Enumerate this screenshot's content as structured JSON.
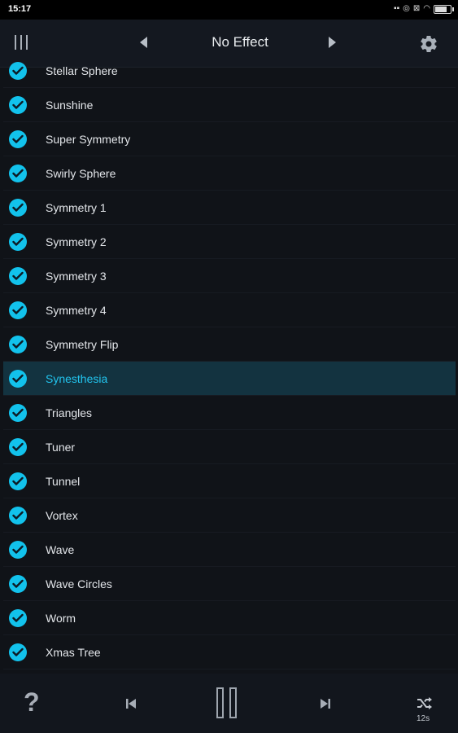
{
  "status": {
    "time": "15:17",
    "icons": [
      "media-icon",
      "screen-record-icon",
      "close-box-icon",
      "wifi-icon",
      "battery-icon"
    ]
  },
  "header": {
    "title": "No Effect"
  },
  "effects": [
    {
      "label": "Stellar Sphere",
      "checked": true,
      "selected": false
    },
    {
      "label": "Sunshine",
      "checked": true,
      "selected": false
    },
    {
      "label": "Super Symmetry",
      "checked": true,
      "selected": false
    },
    {
      "label": "Swirly Sphere",
      "checked": true,
      "selected": false
    },
    {
      "label": "Symmetry 1",
      "checked": true,
      "selected": false
    },
    {
      "label": "Symmetry 2",
      "checked": true,
      "selected": false
    },
    {
      "label": "Symmetry 3",
      "checked": true,
      "selected": false
    },
    {
      "label": "Symmetry 4",
      "checked": true,
      "selected": false
    },
    {
      "label": "Symmetry Flip",
      "checked": true,
      "selected": false
    },
    {
      "label": "Synesthesia",
      "checked": true,
      "selected": true
    },
    {
      "label": "Triangles",
      "checked": true,
      "selected": false
    },
    {
      "label": "Tuner",
      "checked": true,
      "selected": false
    },
    {
      "label": "Tunnel",
      "checked": true,
      "selected": false
    },
    {
      "label": "Vortex",
      "checked": true,
      "selected": false
    },
    {
      "label": "Wave",
      "checked": true,
      "selected": false
    },
    {
      "label": "Wave Circles",
      "checked": true,
      "selected": false
    },
    {
      "label": "Worm",
      "checked": true,
      "selected": false
    },
    {
      "label": "Xmas Tree",
      "checked": true,
      "selected": false
    }
  ],
  "bottom": {
    "help_label": "?",
    "shuffle_interval": "12s"
  },
  "colors": {
    "accent": "#12c2ec",
    "selected_row": "#133340",
    "background": "#101318"
  }
}
